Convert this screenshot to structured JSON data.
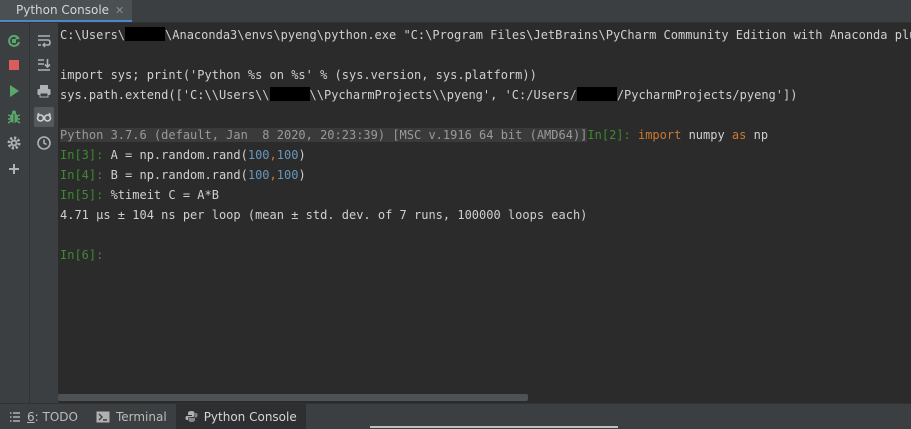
{
  "window": {
    "tab_title": "Python Console",
    "tab_close": "✕"
  },
  "toolbar": {
    "left": [
      {
        "icon": "rerun-icon",
        "color": "#59a869"
      },
      {
        "icon": "stop-icon",
        "color": "#db5c5c"
      },
      {
        "icon": "run-icon",
        "color": "#59a869"
      },
      {
        "icon": "debug-icon",
        "color": "#59a869"
      },
      {
        "icon": "settings-icon",
        "color": "#afb1b3"
      },
      {
        "icon": "add-icon",
        "color": "#afb1b3"
      }
    ],
    "right": [
      {
        "icon": "soft-wrap-icon"
      },
      {
        "icon": "scroll-to-end-icon"
      },
      {
        "icon": "print-icon"
      },
      {
        "icon": "show-variables-icon",
        "active": true
      },
      {
        "icon": "history-icon"
      }
    ]
  },
  "console": {
    "line1_prefix": "C:\\Users\\",
    "line1_suffix": "\\Anaconda3\\envs\\pyeng\\python.exe \"C:\\Program Files\\JetBrains\\PyCharm Community Edition with Anaconda plugin",
    "line2": "import sys; print('Python %s on %s' % (sys.version, sys.platform))",
    "line3_a": "sys.path.extend(['C:\\\\Users\\\\",
    "line3_b": "\\\\PycharmProjects\\\\pyeng', 'C:/Users/",
    "line3_c": "/PycharmProjects/pyeng'])",
    "banner": "Python 3.7.6 (default, Jan  8 2020, 20:23:39) [MSC v.1916 64 bit (AMD64)]",
    "prompt2": "In[2]: ",
    "kw_import": "import",
    "numpy_text": " numpy ",
    "kw_as": "as",
    "np_text": " np",
    "prompt3": "In[3]: ",
    "l3_code": "A = np.random.rand(",
    "prompt4": "In[4]: ",
    "l4_code": "B = np.random.rand(",
    "num100": "100",
    "comma": ",",
    "close_paren": ")",
    "prompt5": "In[5]: ",
    "l5_code": "%timeit C = A*B",
    "output": "4.71 µs ± 104 ns per loop (mean ± std. dev. of 7 runs, 100000 loops each)",
    "prompt6": "In[6]: "
  },
  "bottom_tabs": [
    {
      "icon": "todo-icon",
      "mnemonic": "6",
      "label": ": TODO"
    },
    {
      "icon": "terminal-icon",
      "label": "Terminal"
    },
    {
      "icon": "python-console-icon",
      "label": "Python Console",
      "active": true
    }
  ]
}
